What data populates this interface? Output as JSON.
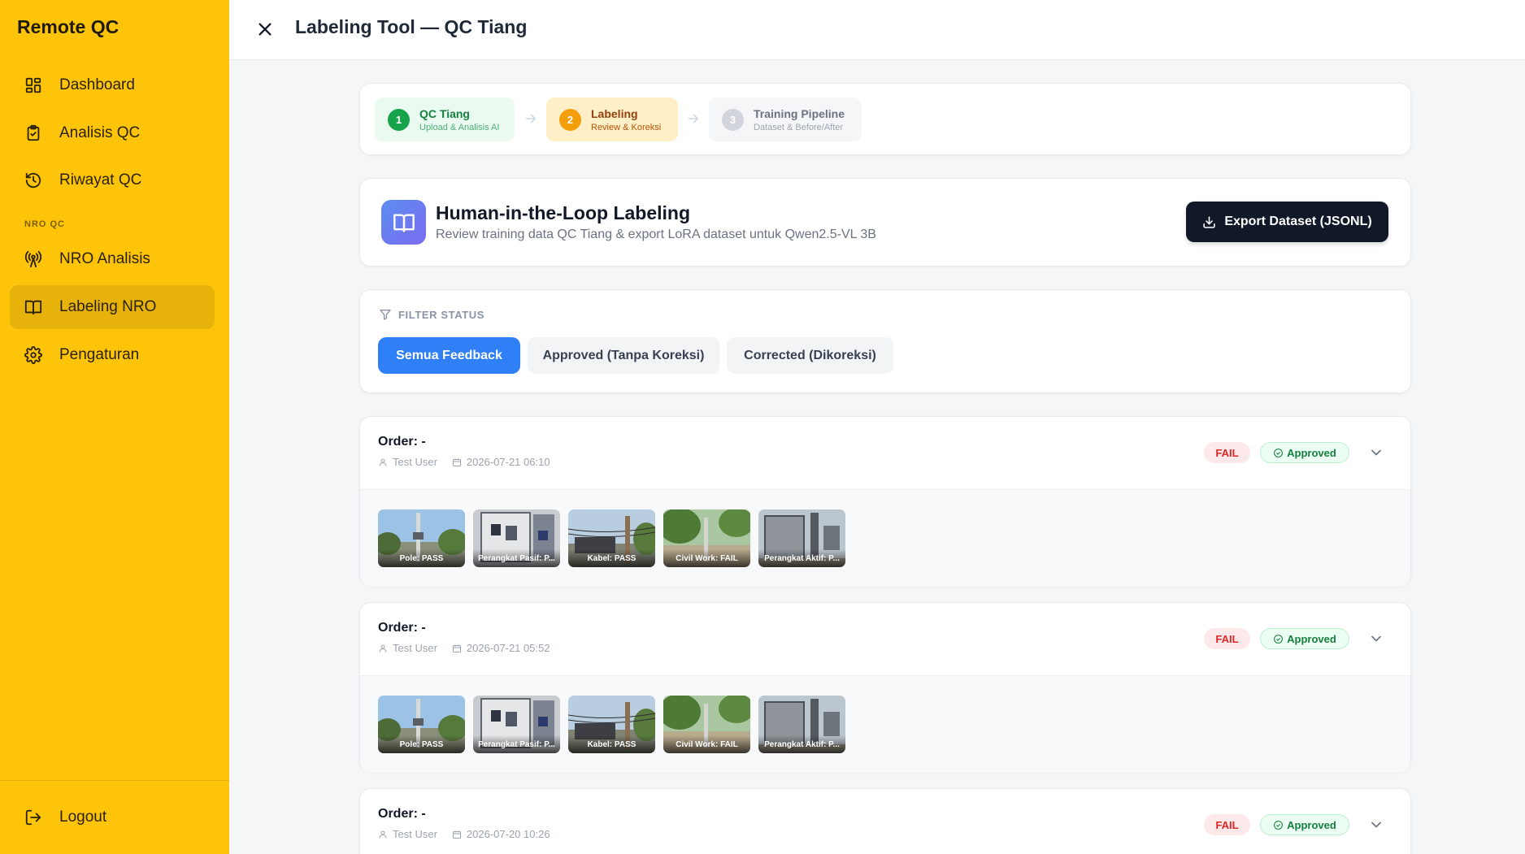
{
  "app": {
    "brand": "Remote QC"
  },
  "sidebar": {
    "items": [
      {
        "label": "Dashboard",
        "icon": "grid-icon"
      },
      {
        "label": "Analisis QC",
        "icon": "clipboard-check-icon"
      },
      {
        "label": "Riwayat QC",
        "icon": "history-icon"
      }
    ],
    "section_label": "NRO QC",
    "nro_items": [
      {
        "label": "NRO Analisis",
        "icon": "radio-tower-icon"
      },
      {
        "label": "Labeling NRO",
        "icon": "book-open-icon",
        "active": true
      },
      {
        "label": "Pengaturan",
        "icon": "gear-icon"
      }
    ],
    "logout_label": "Logout"
  },
  "header": {
    "title": "Labeling Tool — QC Tiang"
  },
  "steps": [
    {
      "num": "1",
      "title": "QC Tiang",
      "subtitle": "Upload & Analisis AI",
      "state": "done"
    },
    {
      "num": "2",
      "title": "Labeling",
      "subtitle": "Review & Koreksi",
      "state": "active"
    },
    {
      "num": "3",
      "title": "Training Pipeline",
      "subtitle": "Dataset & Before/After",
      "state": "pending"
    }
  ],
  "hero": {
    "title": "Human-in-the-Loop Labeling",
    "subtitle": "Review training data QC Tiang & export LoRA dataset untuk Qwen2.5-VL 3B",
    "export_label": "Export Dataset (JSONL)"
  },
  "filter": {
    "label": "FILTER STATUS",
    "options": [
      "Semua Feedback",
      "Approved (Tanpa Koreksi)",
      "Corrected (Dikoreksi)"
    ],
    "selected": "Semua Feedback"
  },
  "orders": [
    {
      "title": "Order: -",
      "user": "Test User",
      "date": "2026-07-21 06:10",
      "result": "FAIL",
      "status": "Approved",
      "thumbs": [
        "Pole: PASS",
        "Perangkat Pasif: P...",
        "Kabel: PASS",
        "Civil Work: FAIL",
        "Perangkat Aktif: P..."
      ]
    },
    {
      "title": "Order: -",
      "user": "Test User",
      "date": "2026-07-21 05:52",
      "result": "FAIL",
      "status": "Approved",
      "thumbs": [
        "Pole: PASS",
        "Perangkat Pasif: P...",
        "Kabel: PASS",
        "Civil Work: FAIL",
        "Perangkat Aktif: P..."
      ]
    },
    {
      "title": "Order: -",
      "user": "Test User",
      "date": "2026-07-20 10:26",
      "result": "FAIL",
      "status": "Approved"
    }
  ],
  "colors": {
    "sidebar": "#fec40a",
    "primary": "#2f80f7",
    "dark_button": "#111827",
    "fail": "#dc2626",
    "approved": "#15803d"
  }
}
